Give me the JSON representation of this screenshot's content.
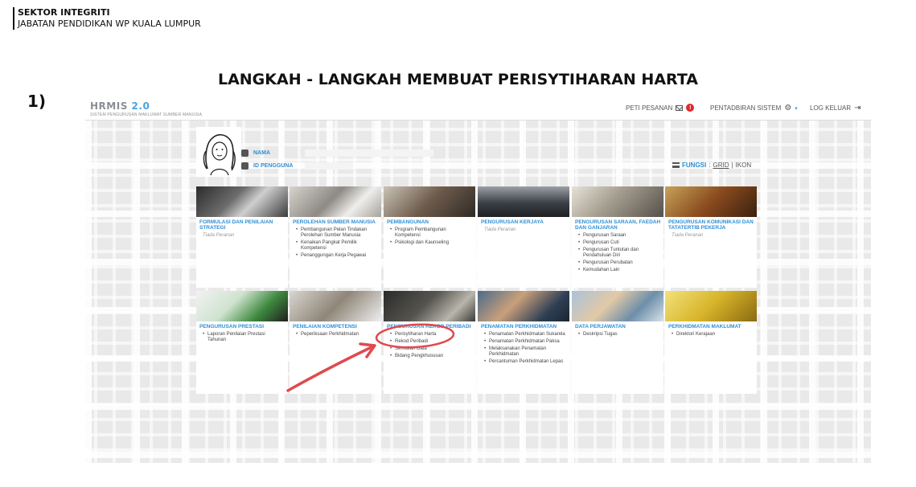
{
  "sector": {
    "line1": "SEKTOR INTEGRITI",
    "line2": "JABATAN PENDIDIKAN WP KUALA LUMPUR"
  },
  "slide": {
    "title": "LANGKAH - LANGKAH MEMBUAT PERISYTIHARAN HARTA",
    "step": "1)"
  },
  "app": {
    "brand": "HRMIS",
    "version": "2.0",
    "subtitle": "SISTEM PENGURUSAN MAKLUMAT SUMBER MANUSIA",
    "nav": {
      "peti": "PETI PESANAN",
      "peti_count": "!",
      "admin": "PENTADBIRAN SISTEM",
      "logout": "LOG KELUAR"
    },
    "profile": {
      "nama_label": "NAMA",
      "id_label": "ID PENGGUNA"
    },
    "view": {
      "fungsi": "FUNGSI",
      "sep1": ":",
      "grid": "GRID",
      "sep2": "|",
      "ikon": "IKON"
    }
  },
  "colors": {
    "accent": "#2c8fd6",
    "badge": "#e0282e",
    "annotation": "#e0494d"
  },
  "tiles": [
    {
      "title": "FORMULASI DAN PENILAIAN STRATEGI",
      "empty": "Tiada Peranan",
      "items": []
    },
    {
      "title": "PEROLEHAN SUMBER MANUSIA",
      "items": [
        "Pembangunan Pelan Tindakan Perolehan Sumber Manusia",
        "Kenaikan Pangkat Pemilik Kompetensi",
        "Penanggungan Kerja Pegawai"
      ]
    },
    {
      "title": "PEMBANGUNAN",
      "items": [
        "Program Pembangunan Kompetensi",
        "Psikologi dan Kaunseling"
      ]
    },
    {
      "title": "PENGURUSAN KERJAYA",
      "empty": "Tiada Peranan",
      "items": []
    },
    {
      "title": "PENGURUSAN SARAAN, FAEDAH DAN GANJARAN",
      "items": [
        "Pengurusan Saraan",
        "Pengurusan Cuti",
        "Pengurusan Tuntutan dan Pendahuluan Diri",
        "Pengurusan Perubatan",
        "Kemudahan Lain"
      ]
    },
    {
      "title": "PENGURUSAN KOMUNIKASI DAN TATATERTIB PEKERJA",
      "empty": "Tiada Peranan",
      "items": []
    },
    {
      "title": "PENGURUSAN PRESTASI",
      "items": [
        "Laporan Penilaian Prestasi Tahunan"
      ]
    },
    {
      "title": "PENILAIAN KOMPETENSI",
      "items": [
        "Peperiksaan Perkhidmatan"
      ]
    },
    {
      "title": "PENGURUSAN REKOD PERIBADI",
      "items": [
        "Perisytiharan Harta",
        "Rekod Peribadi",
        "Semakan Data",
        "Bidang Pengkhususan"
      ]
    },
    {
      "title": "PENAMATAN PERKHIDMATAN",
      "items": [
        "Penamatan Perkhidmatan Sukarela",
        "Penamatan Perkhidmatan Paksa",
        "Melaksanakan Penamatan Perkhidmatan",
        "Percantuman Perkhidmatan Lepas"
      ]
    },
    {
      "title": "DATA PERJAWATAN",
      "items": [
        "Deskripsi Tugas"
      ]
    },
    {
      "title": "PERKHIDMATAN MAKLUMAT",
      "items": [
        "Direktori Kerajaan"
      ]
    }
  ]
}
